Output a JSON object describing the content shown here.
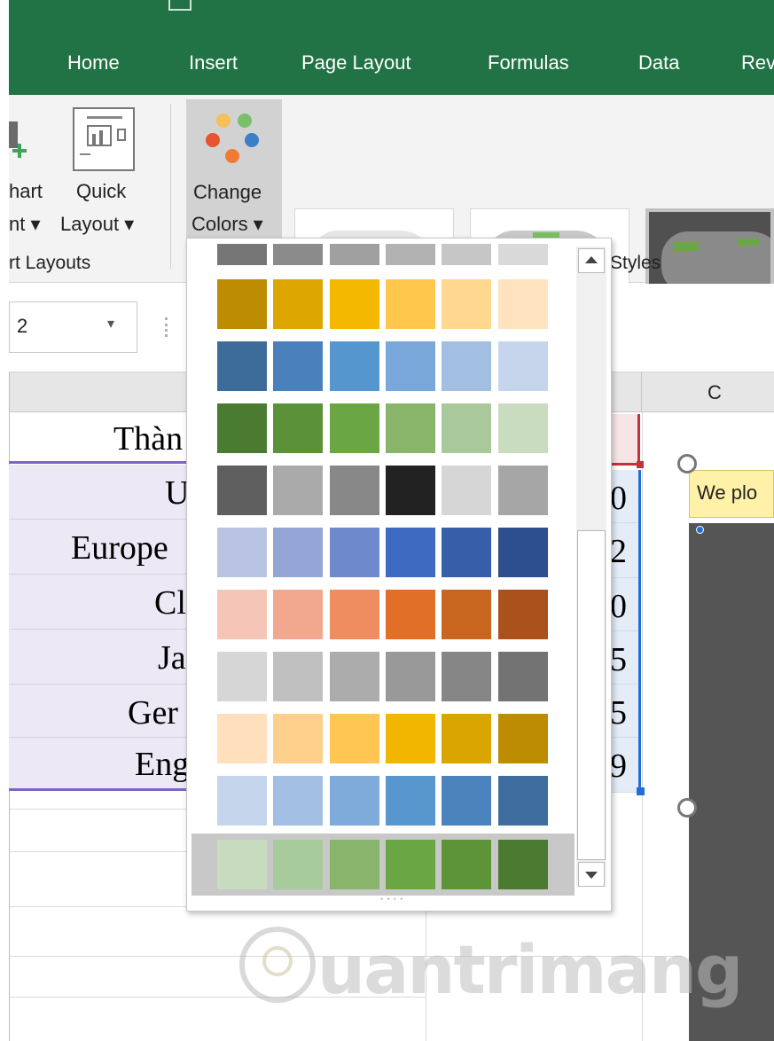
{
  "ribbon_tabs": [
    "Home",
    "Insert",
    "Page Layout",
    "Formulas",
    "Data",
    "Rev"
  ],
  "chart_layouts": {
    "add_chart_line1": "hart",
    "add_chart_line2": "nt ▾",
    "quick_layout_line1": "Quick",
    "quick_layout_line2": "Layout ▾",
    "group_label": "rt Layouts"
  },
  "change_colors": {
    "line1": "Change",
    "line2": "Colors ▾"
  },
  "chart_styles_label": "Styles",
  "name_box": {
    "value": "2",
    "arrow": "▾"
  },
  "column_header": "C",
  "cells": {
    "header": "Thàn",
    "rows": [
      {
        "name": "U",
        "value": "0"
      },
      {
        "name": "Europe",
        "value": "2"
      },
      {
        "name": "Cl",
        "value": "0"
      },
      {
        "name": "Ja",
        "value": "5"
      },
      {
        "name": "Ger",
        "value": "5"
      },
      {
        "name": "Eng",
        "value": "9"
      }
    ]
  },
  "chart_title_text": "We plo",
  "palette": {
    "partial_row": [
      "#767676",
      "#8b8b8b",
      "#a0a0a0",
      "#b2b2b2",
      "#c6c6c6",
      "#d9d9d9"
    ],
    "rows": [
      [
        "#bd8c00",
        "#dea600",
        "#f4b800",
        "#ffc84c",
        "#ffd78e",
        "#ffe3bf"
      ],
      [
        "#3e6c9a",
        "#4a80bc",
        "#5596ce",
        "#7aa7da",
        "#a2bfe2",
        "#c6d5ec"
      ],
      [
        "#4b7a31",
        "#5b9239",
        "#6aa744",
        "#88b56a",
        "#a9c99a",
        "#c9dcc0"
      ],
      [
        "#5f5f5f",
        "#aaaaaa",
        "#888888",
        "#222222",
        "#d6d6d6",
        "#a6a6a6"
      ],
      [
        "#b9c3e2",
        "#94a5d6",
        "#6e89cc",
        "#3e6bc1",
        "#375ea8",
        "#2e4f8e"
      ],
      [
        "#f5c6b7",
        "#f1a88f",
        "#ef8d61",
        "#e26f28",
        "#c8651f",
        "#ab521c"
      ],
      [
        "#d6d6d6",
        "#c0c0c0",
        "#acacac",
        "#999999",
        "#868686",
        "#737373"
      ],
      [
        "#ffdfbc",
        "#ffd08b",
        "#ffc752",
        "#f3b600",
        "#dba500",
        "#bd8c00"
      ],
      [
        "#c5d5ec",
        "#a3bee3",
        "#7fabdb",
        "#5897ce",
        "#4b83bd",
        "#3f6e9e"
      ]
    ],
    "selected_row": [
      "#c7dbbf",
      "#a8cb9b",
      "#88b56b",
      "#6aa744",
      "#5d9339",
      "#4b7a31"
    ]
  },
  "dropdown_resize_grip": "····",
  "watermark": "uantrimang",
  "colors": {
    "ribbon_green": "#217346",
    "accent_blue": "#1f6fd6",
    "accent_red": "#c0333a",
    "purple_border": "#8064c8"
  }
}
